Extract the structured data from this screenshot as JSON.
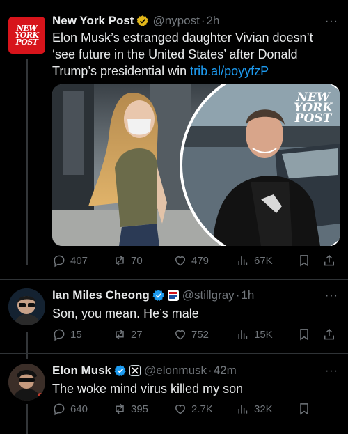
{
  "tweets": [
    {
      "name": "New York Post",
      "handle": "@nypost",
      "time": "2h",
      "logo_lines": [
        "NEW",
        "YORK",
        "POST"
      ],
      "text": "Elon Musk’s estranged daughter Vivian doesn’t ‘see future in the United States’ after Donald Trump’s presidential win ",
      "link": "trib.al/poyyfzP",
      "media_watermark": [
        "NEW",
        "YORK",
        "POST"
      ],
      "replies": "407",
      "reposts": "70",
      "likes": "479",
      "views": "67K"
    },
    {
      "name": "Ian Miles Cheong",
      "handle": "@stillgray",
      "time": "1h",
      "text": "Son, you mean. He’s male",
      "replies": "15",
      "reposts": "27",
      "likes": "752",
      "views": "15K"
    },
    {
      "name": "Elon Musk",
      "handle": "@elonmusk",
      "time": "42m",
      "text": "The woke mind virus killed my son",
      "replies": "640",
      "reposts": "395",
      "likes": "2.7K",
      "views": "32K"
    }
  ],
  "separator": "·",
  "more_glyph": "···",
  "colors": {
    "accent": "#1d9bf0",
    "muted": "#71767b",
    "verified": "#1d9bf0",
    "brand_red": "#d7141b"
  },
  "icons": [
    "reply-icon",
    "repost-icon",
    "like-icon",
    "views-icon",
    "bookmark-icon",
    "share-icon",
    "verified-icon",
    "more-icon"
  ]
}
